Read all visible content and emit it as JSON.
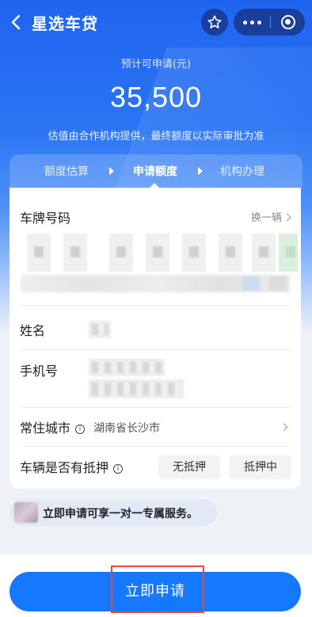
{
  "header": {
    "title": "星选车贷"
  },
  "quota": {
    "label": "预计可申请(元)",
    "amount": "35,500",
    "note": "估值由合作机构提供，最终额度以实际审批为准"
  },
  "steps": [
    {
      "label": "额度估算",
      "active": false
    },
    {
      "label": "申请额度",
      "active": true
    },
    {
      "label": "机构办理",
      "active": false
    }
  ],
  "form": {
    "plate_label": "车牌号码",
    "switch_label": "换一辆",
    "name_label": "姓名",
    "phone_label": "手机号",
    "city_label": "常住城市",
    "city_value": "湖南省长沙市",
    "mortgage_label": "车辆是否有抵押",
    "mortgage_options": [
      "无抵押",
      "抵押中"
    ]
  },
  "banner": {
    "text": "立即申请可享一对一专属服务。"
  },
  "apply_button": {
    "label": "立即申请"
  },
  "colors": {
    "primary": "#1677ff",
    "header": "#1f64ef",
    "highlight_box": "#e5483f"
  }
}
